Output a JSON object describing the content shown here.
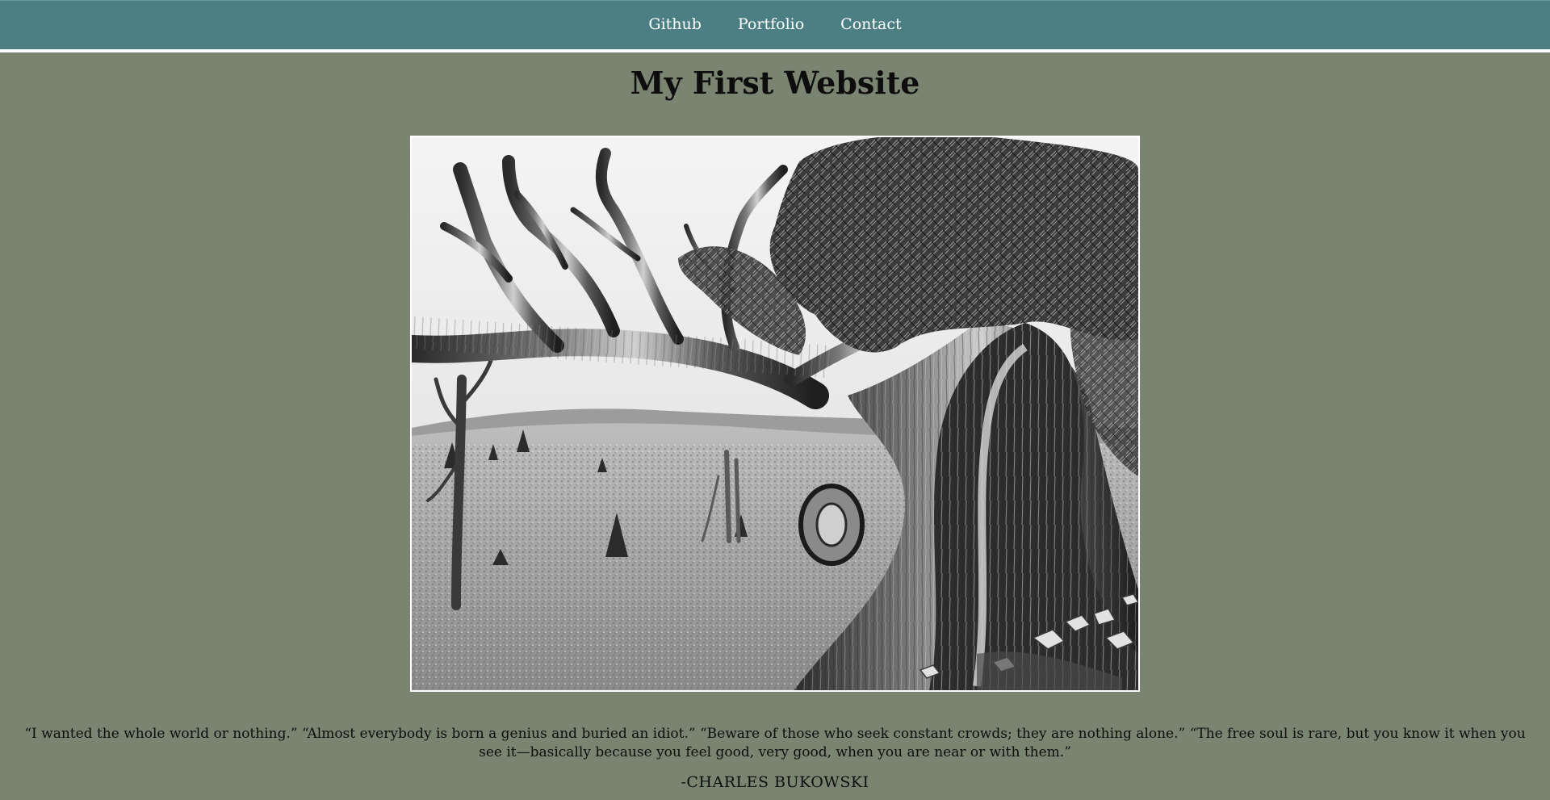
{
  "nav": {
    "items": [
      {
        "label": "Github"
      },
      {
        "label": "Portfolio"
      },
      {
        "label": "Contact"
      }
    ]
  },
  "header": {
    "title": "My First Website"
  },
  "hero": {
    "icon": "bristlecone-pine-photo"
  },
  "quote": {
    "text": "“I wanted the whole world or nothing.” “Almost everybody is born a genius and buried an idiot.” “Beware of those who seek constant crowds; they are nothing alone.” “The free soul is rare, but you know it when you see it—basically because you feel good, very good, when you are near or with them.”",
    "author": "-CHARLES BUKOWSKI"
  },
  "colors": {
    "background": "#7a8571",
    "navbar": "#4c7f83",
    "nav_text": "#ffffff",
    "text": "#0d0d0d"
  }
}
